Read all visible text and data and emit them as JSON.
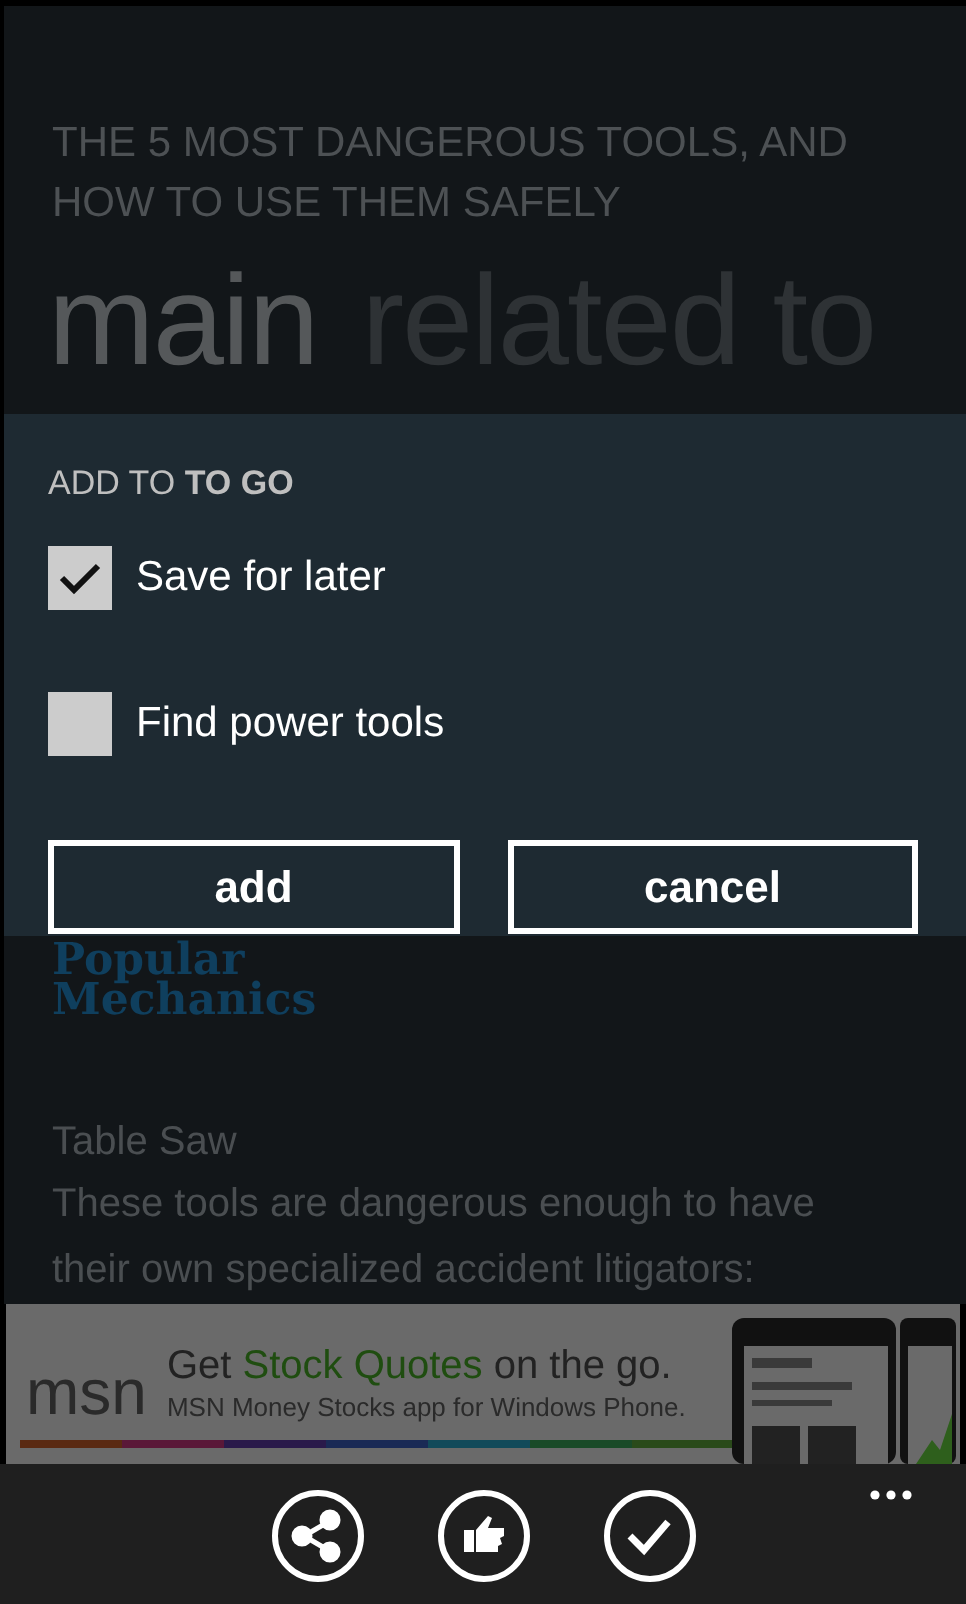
{
  "article": {
    "title": "THE 5 MOST DANGEROUS TOOLS, AND HOW TO USE THEM SAFELY"
  },
  "pivot": [
    {
      "label": "main",
      "selected": true
    },
    {
      "label": "related to",
      "selected": false
    }
  ],
  "dialog": {
    "heading": "ADD TO **TO GO**",
    "options": [
      {
        "label": "Save for later",
        "checked": true
      },
      {
        "label": "Find power tools",
        "checked": false
      }
    ],
    "buttons": [
      "add",
      "cancel"
    ]
  },
  "content": {
    "source_logo": "Popular Mechanics",
    "subheading": "Table Saw",
    "body": "These tools are dangerous enough to have their own specialized accident litigators:"
  },
  "ad": {
    "brand": "msn",
    "headline": [
      {
        "text": "Get ",
        "highlight": false
      },
      {
        "text": "Stock Quotes",
        "highlight": true
      },
      {
        "text": " on the go.",
        "highlight": false
      }
    ],
    "tagline": "MSN Money Stocks app for Windows Phone.",
    "kind": "picture"
  },
  "app_bar": {
    "buttons": [
      {
        "kind": "share"
      },
      {
        "kind": "like"
      },
      {
        "kind": "check"
      }
    ]
  }
}
